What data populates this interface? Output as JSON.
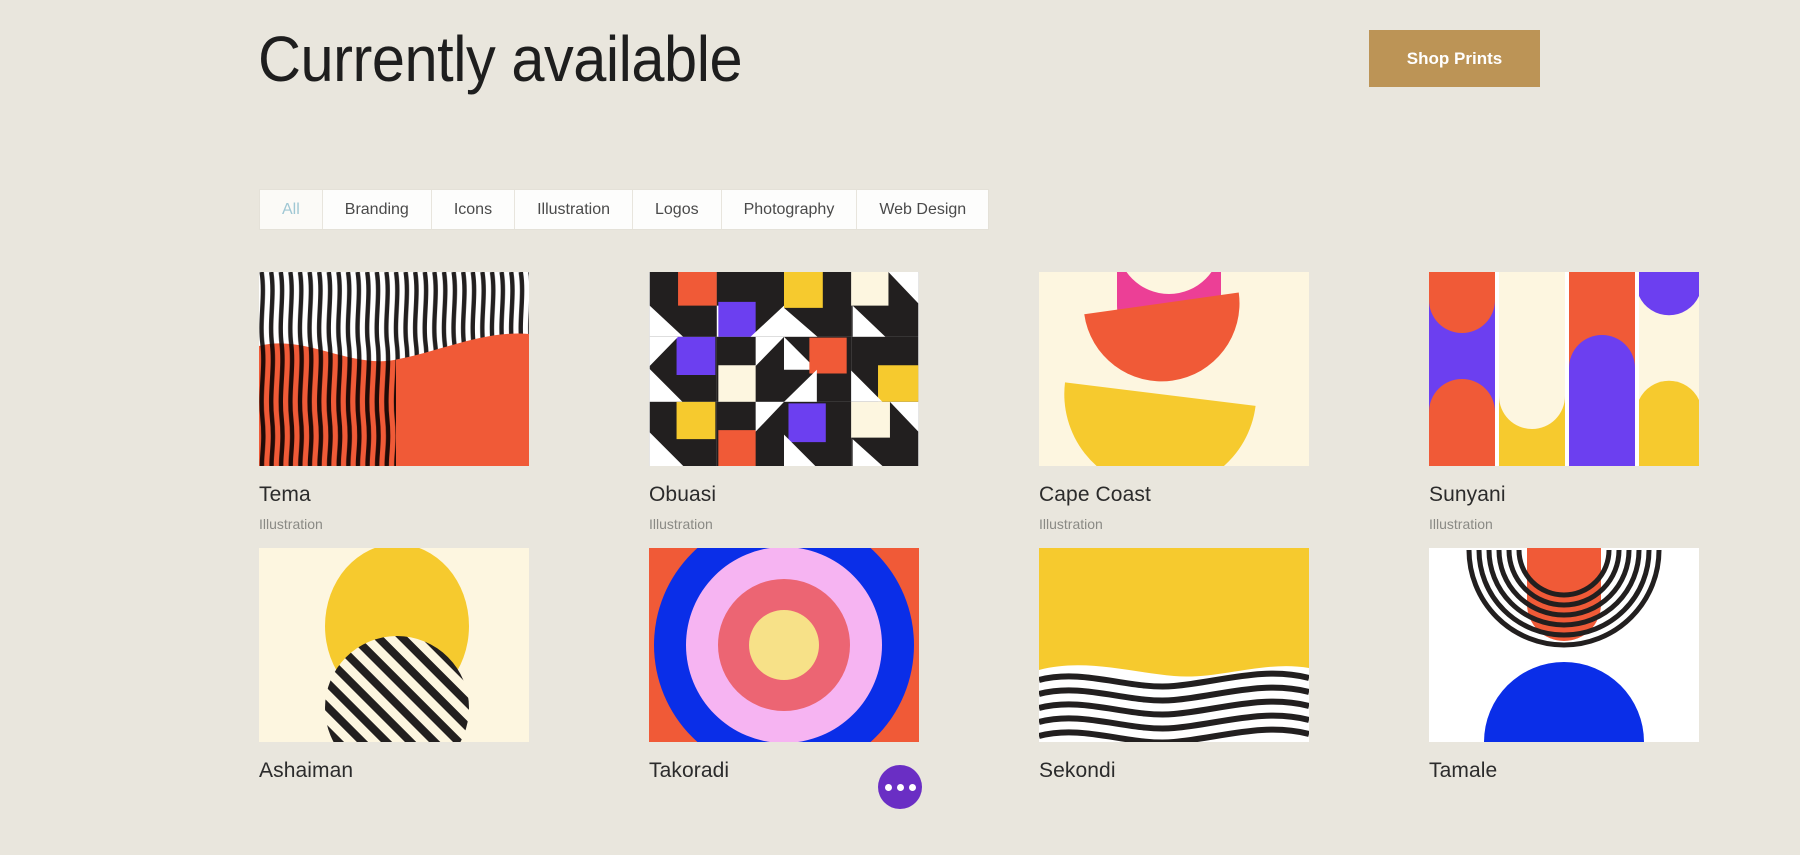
{
  "header": {
    "title": "Currently available",
    "shop_button": "Shop Prints"
  },
  "filters": {
    "tabs": [
      {
        "label": "All",
        "active": true
      },
      {
        "label": "Branding",
        "active": false
      },
      {
        "label": "Icons",
        "active": false
      },
      {
        "label": "Illustration",
        "active": false
      },
      {
        "label": "Logos",
        "active": false
      },
      {
        "label": "Photography",
        "active": false
      },
      {
        "label": "Web Design",
        "active": false
      }
    ]
  },
  "gallery": {
    "items": [
      {
        "title": "Tema",
        "category": "Illustration",
        "art": "wavy-vertical-stripes-orange"
      },
      {
        "title": "Obuasi",
        "category": "Illustration",
        "art": "geometric-blocks"
      },
      {
        "title": "Cape Coast",
        "category": "Illustration",
        "art": "stacked-bowls"
      },
      {
        "title": "Sunyani",
        "category": "Illustration",
        "art": "arch-columns"
      },
      {
        "title": "Ashaiman",
        "category": "",
        "art": "sun-striped-circle"
      },
      {
        "title": "Takoradi",
        "category": "",
        "art": "concentric-circles"
      },
      {
        "title": "Sekondi",
        "category": "",
        "art": "yellow-wave-stripes"
      },
      {
        "title": "Tamale",
        "category": "",
        "art": "arcs-and-dome"
      }
    ]
  },
  "fab": {
    "label": "more-options"
  },
  "colors": {
    "page_background": "#e9e6dd",
    "accent_gold": "#bc9456",
    "tab_active": "#9fc7d4",
    "fab_purple": "#6a2ec4",
    "art_orange": "#f05a37",
    "art_yellow": "#f6ca2e",
    "art_purple": "#6c3ff0",
    "art_cream": "#fdf6e0",
    "art_black": "#221f1f",
    "art_blue": "#0a2ee8",
    "art_pink": "#ec3f96",
    "art_coral": "#ec6573",
    "art_lightpink": "#f6b4f2"
  }
}
